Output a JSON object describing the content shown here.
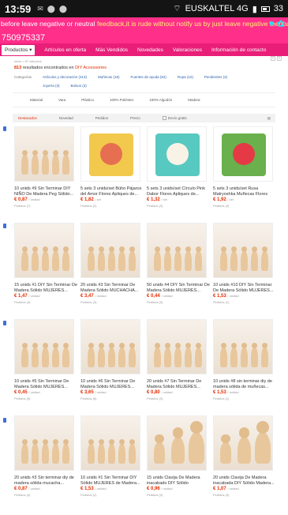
{
  "status": {
    "time": "13:59",
    "carrier": "EUSKALTEL 4G",
    "battery": "33"
  },
  "banner": {
    "text_a": "before leave negative or neutral",
    "text_b": "feedback,it is rude without notify us by just leave negative feedback"
  },
  "store_id": "750975337",
  "nav": {
    "products": "Productos",
    "items": [
      "Artículos en oferta",
      "Más Vendidos",
      "Novedades",
      "Valoraciones",
      "Información de contacto"
    ]
  },
  "breadcrumb": "Inicio > 87 artículos",
  "results": {
    "count": "813",
    "text": "resultados encontrados en",
    "category": "DIY Accessories"
  },
  "filters": {
    "category_label": "Categorías",
    "row1": [
      "Artículos y decoración (313)",
      "Muñecas (16)",
      "Fuentes de ayuda (52)",
      "Ropa (10)",
      "Pendientes (2)"
    ],
    "row2": [
      "Joyería (3)",
      "Bolsos (3)"
    ],
    "attrs": [
      "Material",
      "Vara",
      "Plástico",
      "100% Poliéster",
      "100% Algodón",
      "Madera"
    ]
  },
  "sort": {
    "options": [
      "Destacados",
      "Novedad",
      "Pedidos",
      "Precio"
    ],
    "free_shipping": "Envío gratis"
  },
  "products": [
    {
      "title": "10 unids #9 Sin Terminar DIY NIÑO De Madera Peg Sólido...",
      "price": "€ 0,87",
      "unit": "/ unidad",
      "orders": "Pedidos (7)"
    },
    {
      "title": "5 sets 3 unids/set Búho Pájaros del Amor Flores Apliques de...",
      "price": "€ 1,82",
      "unit": "/ set",
      "orders": "Pedidos (2)"
    },
    {
      "title": "5 sets 3 unids/set Círculo Pink Dabor Flores Apliques de...",
      "price": "€ 1,32",
      "unit": "/ set",
      "orders": "Pedidos (3)"
    },
    {
      "title": "5 sets 3 unids/set Rusa Matryoshka Muñecas Flores En...",
      "price": "€ 1,92",
      "unit": "/ set",
      "orders": "Pedidos (3)"
    },
    {
      "title": "15 unids #1 DIY Sin Terminar De Madera Sólido MUJERES...",
      "price": "€ 1,47",
      "unit": "/ unidad",
      "orders": "Pedidos (4)"
    },
    {
      "title": "20 unids #3 Sin Terminar De Madera Sólido MUCHACHA...",
      "price": "€ 3,47",
      "unit": "/ unidad",
      "orders": "Pedidos (3)"
    },
    {
      "title": "50 unids #4 DIY Sin Terminar De Madera Sólido MUJERES...",
      "price": "€ 0,44",
      "unit": "/ unidad",
      "orders": "Pedidos (9)"
    },
    {
      "title": "10 unids #10 DIY Sin Terminar De Madera Sólido MUJERES...",
      "price": "€ 1,53",
      "unit": "/ unidad",
      "orders": "Pedidos (1)"
    },
    {
      "title": "10 unids #5 Sin Terminar De Madera Sólido MUJERES...",
      "price": "€ 0,45",
      "unit": "/ unidad",
      "orders": "Pedidos (5)"
    },
    {
      "title": "10 unids #6 Sin Terminar De Madera Sólido MUJERES...",
      "price": "€ 3,65",
      "unit": "/ unidad",
      "orders": "Pedidos (6)"
    },
    {
      "title": "20 unids #7 Sin Terminar De Madera Sólido MUJERES...",
      "price": "€ 0,80",
      "unit": "/ unidad",
      "orders": "Pedidos (3)"
    },
    {
      "title": "10 unids #8 sin terminar diy de madera sólida de muñecas...",
      "price": "€ 1,53",
      "unit": "/ unidad",
      "orders": "Pedidos (1)"
    },
    {
      "title": "20 unids #3 Sin terminar diy de madera sólida mucacha...",
      "price": "€ 0,87",
      "unit": "/ unidad",
      "orders": "Pedidos (4)"
    },
    {
      "title": "10 unids #1 Sin Terminar DIY Sólido MUJERES de Madera...",
      "price": "€ 1,53",
      "unit": "/ unidad",
      "orders": "Pedidos (2)"
    },
    {
      "title": "15 unids Clavija De Madera inacabado DIY Sólido Muñecas...",
      "price": "€ 0,96",
      "unit": "/ unidad",
      "orders": "Pedidos (3)"
    },
    {
      "title": "20 unids Clavija De Madera inacabada DIY Sólido Madera...",
      "price": "€ 1,07",
      "unit": "/ unidad",
      "orders": "Pedidos (3)"
    }
  ]
}
